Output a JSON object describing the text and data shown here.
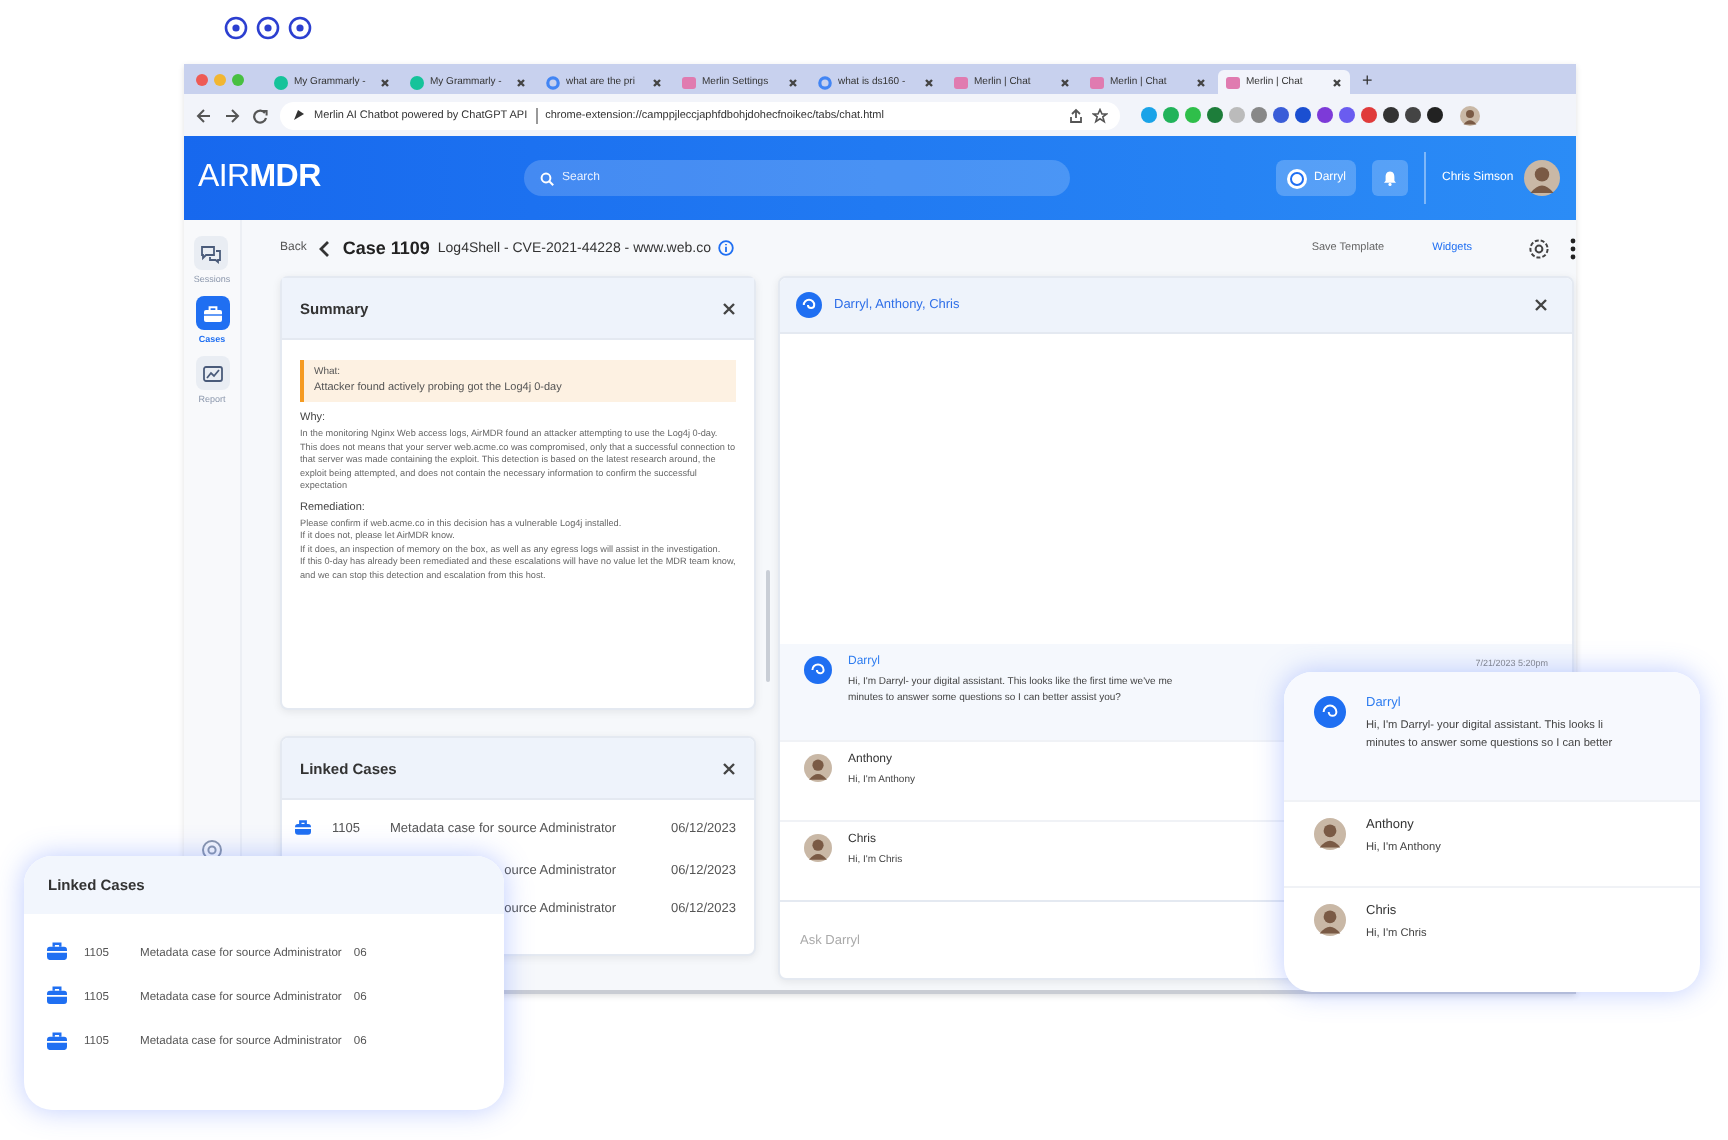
{
  "browser": {
    "tabs": [
      {
        "title": "My Grammarly - ",
        "kind": "grammarly",
        "selected": false
      },
      {
        "title": "My Grammarly - ",
        "kind": "grammarly",
        "selected": false
      },
      {
        "title": "what are the pri",
        "kind": "google",
        "selected": false
      },
      {
        "title": "Merlin Settings",
        "kind": "merlin",
        "selected": false
      },
      {
        "title": "what is ds160 - ",
        "kind": "google",
        "selected": false
      },
      {
        "title": "Merlin | Chat",
        "kind": "merlin",
        "selected": false
      },
      {
        "title": "Merlin | Chat",
        "kind": "merlin",
        "selected": false
      },
      {
        "title": "Merlin | Chat",
        "kind": "merlin",
        "selected": true
      }
    ],
    "new_tab": "+",
    "page_title": "Merlin AI Chatbot powered by ChatGPT API",
    "url": "chrome-extension://camppjleccjaphfdbohjdohecfnoikec/tabs/chat.html"
  },
  "header": {
    "logo": "AIR**MDR**",
    "search": {
      "placeholder": "Search"
    },
    "assistant": "Darryl",
    "user": "Chris Simson"
  },
  "sidebar": {
    "items": [
      {
        "label": "Sessions",
        "kind": "chat",
        "selected": false
      },
      {
        "label": "Cases",
        "kind": "case",
        "selected": true
      },
      {
        "label": "Report",
        "kind": "report",
        "selected": false
      }
    ]
  },
  "case_header": {
    "back": "Back",
    "case_number": "Case 1109",
    "subtitle": "Log4Shell - CVE-2021-44228 - www.web.co",
    "actions": [
      {
        "label": "Save Template",
        "kind": "secondary"
      },
      {
        "label": "Widgets",
        "kind": "primary"
      }
    ]
  },
  "summary": {
    "title": "Summary",
    "what": {
      "label": "What:",
      "text": "Attacker found actively probing got the Log4j 0-day"
    },
    "sections": [
      {
        "label": "Why:",
        "paragraphs": [
          "In the monitoring Nginx Web access logs, AirMDR found an attacker attempting to use the Log4j 0-day. This does not means that your server web.acme.co was compromised, only that a successful connection to that server was made containing the exploit. This detection is based on the latest research around, the exploit being attempted, and does not contain the necessary information to confirm the successful expectation"
        ]
      },
      {
        "label": "Remediation:",
        "paragraphs": [
          "Please confirm if web.acme.co in this decision has a vulnerable Log4j installed.",
          "If it does not, please let AirMDR know.",
          "If it does, an inspection of memory on the box, as well as any egress logs will assist in the investigation.",
          "If this 0-day has already been remediated and these escalations will have no value let the MDR team know, and we can stop this detection and escalation from this host."
        ]
      }
    ]
  },
  "linked_cases": {
    "title": "Linked Cases",
    "rows": [
      {
        "id": "1105",
        "description": "Metadata case for source Administrator",
        "date": "06/12/2023"
      },
      {
        "description": "ource Administrator",
        "date": "06/12/2023"
      },
      {
        "description": "ource Administrator",
        "date": "06/12/2023"
      }
    ]
  },
  "chat": {
    "title": "Darryl, Anthony, Chris",
    "messages": [
      {
        "kind": "bot",
        "author": "Darryl",
        "time": "7/21/2023 5:20pm",
        "lines": [
          "Hi, I'm Darryl- your digital assistant.  This looks like the first time we've me",
          "minutes to answer some questions so I can better assist you?"
        ]
      },
      {
        "kind": "user",
        "author": "Anthony",
        "lines": [
          "Hi, I'm Anthony"
        ]
      },
      {
        "kind": "user",
        "author": "Chris",
        "lines": [
          "Hi, I'm Chris"
        ]
      }
    ],
    "input": {
      "placeholder": "Ask Darryl"
    }
  },
  "callouts": {
    "linked_cases": {
      "title": "Linked Cases",
      "rows": [
        {
          "id": "1105",
          "description": "Metadata case for source Administrator",
          "date": "06"
        },
        {
          "id": "1105",
          "description": "Metadata case for source Administrator",
          "date": "06"
        },
        {
          "id": "1105",
          "description": "Metadata case for source Administrator",
          "date": "06"
        }
      ]
    },
    "chat": {
      "messages": [
        {
          "kind": "bot",
          "author": "Darryl",
          "lines": [
            "Hi, I'm Darryl- your digital assistant.  This looks li",
            "minutes to answer some questions so I can better"
          ]
        },
        {
          "kind": "user",
          "author": "Anthony",
          "lines": [
            "Hi, I'm Anthony"
          ]
        },
        {
          "kind": "user",
          "author": "Chris",
          "lines": [
            "Hi, I'm Chris"
          ]
        }
      ]
    }
  }
}
